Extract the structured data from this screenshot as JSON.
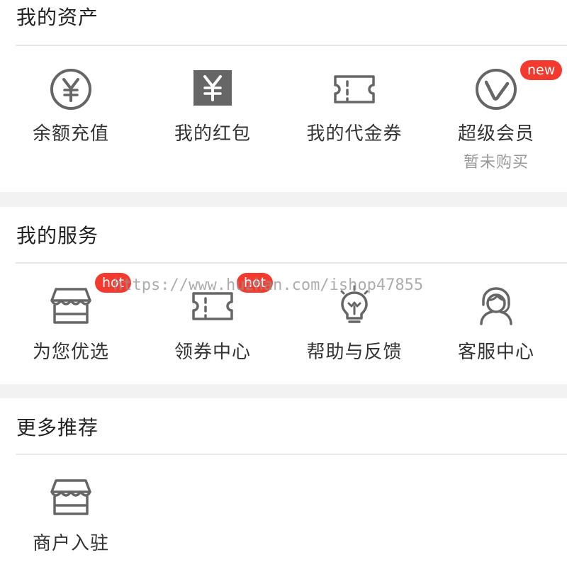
{
  "assets": {
    "title": "我的资产",
    "items": [
      {
        "label": "余额充值",
        "icon": "yuan-circle-icon"
      },
      {
        "label": "我的红包",
        "icon": "red-packet-icon"
      },
      {
        "label": "我的代金券",
        "icon": "ticket-icon"
      },
      {
        "label": "超级会员",
        "icon": "vip-v-icon",
        "sub": "暂未购买",
        "badge": "new"
      }
    ]
  },
  "services": {
    "title": "我的服务",
    "items": [
      {
        "label": "为您优选",
        "icon": "store-icon",
        "badge": "hot"
      },
      {
        "label": "领券中心",
        "icon": "ticket-icon",
        "badge": "hot"
      },
      {
        "label": "帮助与反馈",
        "icon": "lightbulb-icon"
      },
      {
        "label": "客服中心",
        "icon": "headset-icon"
      }
    ]
  },
  "more": {
    "title": "更多推荐",
    "items": [
      {
        "label": "商户入驻",
        "icon": "store-icon"
      }
    ]
  },
  "watermark": "https://www.huzhan.com/ishop47855",
  "colors": {
    "badge": "#f33a2f",
    "icon": "#666666",
    "section_gap": "#f2f2f2",
    "secondary_text": "#999999"
  }
}
